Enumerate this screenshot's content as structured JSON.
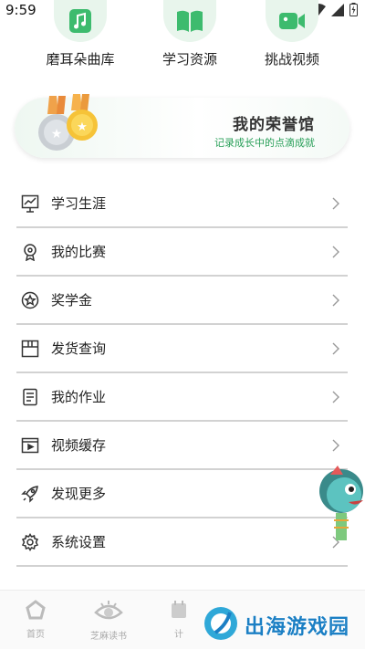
{
  "status_bar": {
    "time": "9:59"
  },
  "quick_entries": [
    {
      "label": "磨耳朵曲库",
      "icon": "music-icon"
    },
    {
      "label": "学习资源",
      "icon": "book-icon"
    },
    {
      "label": "挑战视频",
      "icon": "video-icon"
    }
  ],
  "honor": {
    "title": "我的荣誉馆",
    "subtitle": "记录成长中的点滴成就"
  },
  "menu": [
    {
      "label": "学习生涯",
      "icon": "career-chart-icon"
    },
    {
      "label": "我的比赛",
      "icon": "trophy-icon"
    },
    {
      "label": "奖学金",
      "icon": "star-badge-icon"
    },
    {
      "label": "发货查询",
      "icon": "package-icon"
    },
    {
      "label": "我的作业",
      "icon": "homework-icon"
    },
    {
      "label": "视频缓存",
      "icon": "video-cache-icon"
    },
    {
      "label": "发现更多",
      "icon": "rocket-icon"
    },
    {
      "label": "系统设置",
      "icon": "gear-icon"
    }
  ],
  "bottom_nav": [
    {
      "label": "首页",
      "icon": "home-icon"
    },
    {
      "label": "芝麻读书",
      "icon": "eye-reading-icon"
    },
    {
      "label": "计",
      "icon": "calendar-icon"
    }
  ],
  "watermark": {
    "text": "出海游戏园"
  },
  "colors": {
    "accent_green": "#2aa05a",
    "divider": "#d2d2d2",
    "watermark_blue": "#1b7fc4"
  }
}
